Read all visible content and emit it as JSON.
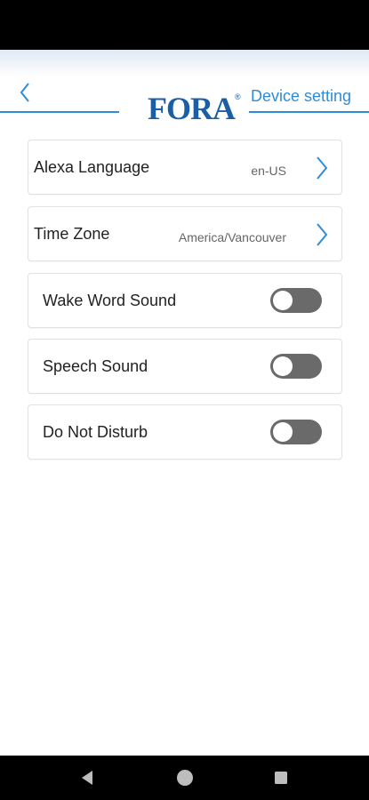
{
  "header": {
    "logo_text": "FORA",
    "logo_mark": "®",
    "title": "Device setting",
    "back_icon": "chevron-left-icon"
  },
  "settings": {
    "navigation_rows": [
      {
        "label": "Alexa Language",
        "value": "en-US",
        "icon": "chevron-right-icon"
      },
      {
        "label": "Time Zone",
        "value": "America/Vancouver",
        "icon": "chevron-right-icon"
      }
    ],
    "toggle_rows": [
      {
        "label": "Wake Word Sound",
        "enabled": false
      },
      {
        "label": "Speech Sound",
        "enabled": false
      },
      {
        "label": "Do Not Disturb",
        "enabled": false
      }
    ]
  },
  "system_nav": {
    "buttons": [
      "back-triangle-icon",
      "home-circle-icon",
      "recents-square-icon"
    ]
  },
  "colors": {
    "accent": "#2f8cd6",
    "logo": "#1a5ea8",
    "toggle_off": "#6a6a6a",
    "status_bar": "#000000"
  }
}
